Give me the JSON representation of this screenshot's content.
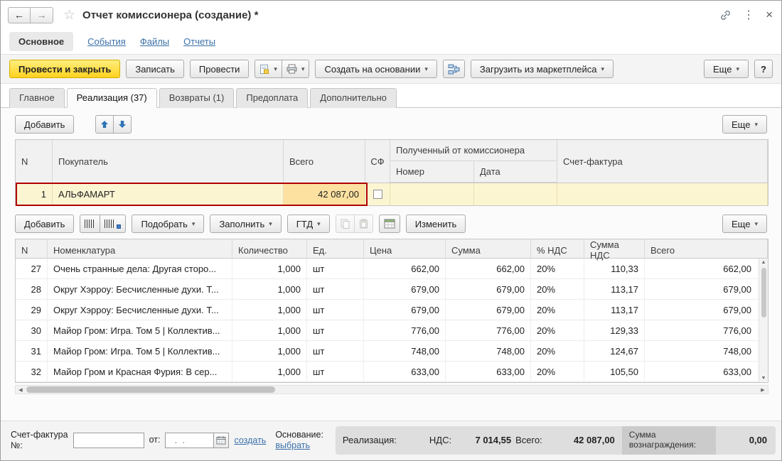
{
  "titlebar": {
    "title": "Отчет комиссионера (создание) *"
  },
  "glyphs": {
    "back": "←",
    "forward": "→",
    "star": "☆",
    "kebab": "⋮",
    "close": "×",
    "caret": "▾",
    "sb_left": "◀",
    "sb_right": "▶",
    "sb_up": "▲",
    "sb_down": "▼"
  },
  "nav": {
    "items": [
      {
        "label": "Основное",
        "active": true
      },
      {
        "label": "События"
      },
      {
        "label": "Файлы"
      },
      {
        "label": "Отчеты"
      }
    ]
  },
  "toolbar": {
    "post_and_close": "Провести и закрыть",
    "write": "Записать",
    "post": "Провести",
    "create_based_on": "Создать на основании",
    "load_from_marketplace": "Загрузить из маркетплейса",
    "more": "Еще",
    "help": "?"
  },
  "tabs": [
    "Главное",
    "Реализация (37)",
    "Возвраты (1)",
    "Предоплата",
    "Дополнительно"
  ],
  "upper": {
    "add": "Добавить",
    "more": "Еще",
    "headers": {
      "n": "N",
      "buyer": "Покупатель",
      "total": "Всего",
      "sf": "СФ",
      "received_group": "Полученный от комиссионера",
      "number": "Номер",
      "date": "Дата",
      "invoice": "Счет-фактура"
    },
    "row": {
      "n": "1",
      "buyer": "АЛЬФАМАРТ",
      "total": "42 087,00",
      "sf_checked": false,
      "number": "",
      "date": "",
      "invoice": ""
    }
  },
  "middle": {
    "add": "Добавить",
    "pick": "Подобрать",
    "fill": "Заполнить",
    "gtd": "ГТД",
    "edit": "Изменить",
    "more": "Еще"
  },
  "lower": {
    "headers": [
      "N",
      "Номенклатура",
      "Количество",
      "Ед.",
      "Цена",
      "Сумма",
      "% НДС",
      "Сумма НДС",
      "Всего"
    ],
    "rows": [
      [
        "27",
        "Очень странные дела: Другая сторо...",
        "1,000",
        "шт",
        "662,00",
        "662,00",
        "20%",
        "110,33",
        "662,00"
      ],
      [
        "28",
        "Округ Хэрроу: Бесчисленные духи. Т...",
        "1,000",
        "шт",
        "679,00",
        "679,00",
        "20%",
        "113,17",
        "679,00"
      ],
      [
        "29",
        "Округ Хэрроу: Бесчисленные духи. Т...",
        "1,000",
        "шт",
        "679,00",
        "679,00",
        "20%",
        "113,17",
        "679,00"
      ],
      [
        "30",
        "Майор Гром: Игра. Том 5 | Коллектив...",
        "1,000",
        "шт",
        "776,00",
        "776,00",
        "20%",
        "129,33",
        "776,00"
      ],
      [
        "31",
        "Майор Гром: Игра. Том 5 | Коллектив...",
        "1,000",
        "шт",
        "748,00",
        "748,00",
        "20%",
        "124,67",
        "748,00"
      ],
      [
        "32",
        "Майор Гром и Красная Фурия: В сер...",
        "1,000",
        "шт",
        "633,00",
        "633,00",
        "20%",
        "105,50",
        "633,00"
      ]
    ]
  },
  "footer": {
    "invoice_line1": "Счет-фактура",
    "invoice_line2": "№:",
    "invoice_value": "",
    "from_label": "от:",
    "date_placeholder": "  .  .",
    "create_link": "создать",
    "basis_label": "Основание:",
    "choose_link": "выбрать",
    "status": {
      "realization_label": "Реализация:",
      "vat_label": "НДС:",
      "vat_value": "7 014,55",
      "total_label": "Всего:",
      "total_value": "42 087,00",
      "fee_label": "Сумма вознаграждения:",
      "fee_value": "0,00"
    }
  },
  "colors": {
    "accent_yellow": "#ffd21f",
    "selection_red": "#b00000",
    "row_highlight": "#fcf5d2",
    "cell_highlight": "#fde1a1",
    "link_blue": "#3a71a8"
  }
}
